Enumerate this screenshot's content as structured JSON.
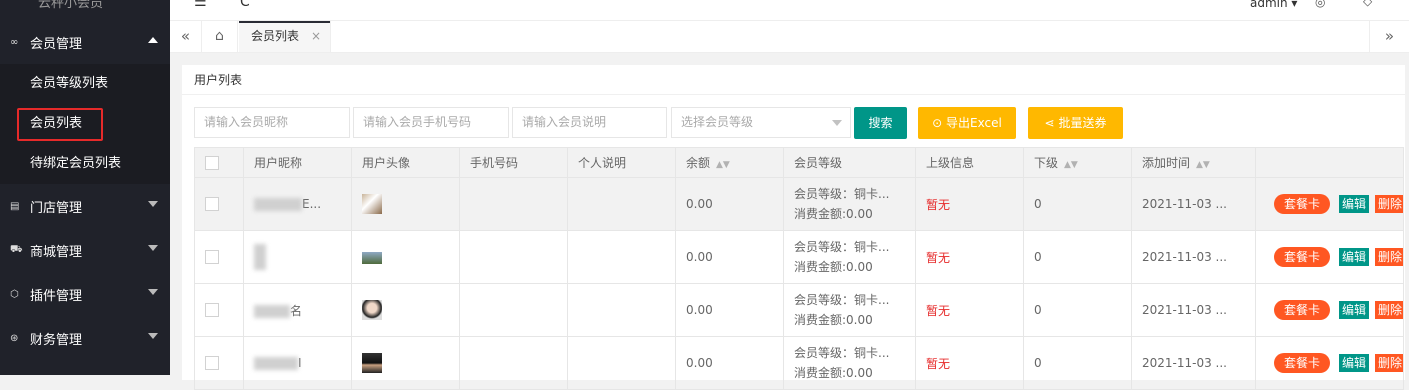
{
  "sidebar": {
    "brand": "云秤小会员",
    "groups": [
      {
        "label": "会员管理",
        "icon": "member-icon",
        "expanded": true
      },
      {
        "label": "门店管理",
        "icon": "store-icon",
        "expanded": false
      },
      {
        "label": "商城管理",
        "icon": "cart-icon",
        "expanded": false
      },
      {
        "label": "插件管理",
        "icon": "plugin-icon",
        "expanded": false
      },
      {
        "label": "财务管理",
        "icon": "finance-icon",
        "expanded": false
      }
    ],
    "subitems": [
      {
        "label": "会员等级列表"
      },
      {
        "label": "会员列表",
        "active": true
      },
      {
        "label": "待绑定会员列表"
      }
    ]
  },
  "topbar": {
    "user": "admin ▾"
  },
  "tabs": {
    "active_label": "会员列表"
  },
  "panel": {
    "title": "用户列表"
  },
  "filters": {
    "nickname_placeholder": "请输入会员昵称",
    "phone_placeholder": "请输入会员手机号码",
    "desc_placeholder": "请输入会员说明",
    "level_placeholder": "选择会员等级",
    "search_label": "搜索",
    "excel_label": "导出Excel",
    "coupon_label": "批量送券"
  },
  "table": {
    "headers": [
      "用户昵称",
      "用户头像",
      "手机号码",
      "个人说明",
      "余额",
      "会员等级",
      "上级信息",
      "下级",
      "添加时间"
    ],
    "rows": [
      {
        "nick_suffix": "E...",
        "balance": "0.00",
        "level": "会员等级：铜卡...",
        "spend": "消费金额:0.00",
        "parent": "暂无",
        "children": "0",
        "time": "2021-11-03 ..."
      },
      {
        "nick_suffix": "",
        "balance": "0.00",
        "level": "会员等级：铜卡...",
        "spend": "消费金额:0.00",
        "parent": "暂无",
        "children": "0",
        "time": "2021-11-03 ..."
      },
      {
        "nick_suffix": "名",
        "balance": "0.00",
        "level": "会员等级：铜卡...",
        "spend": "消费金额:0.00",
        "parent": "暂无",
        "children": "0",
        "time": "2021-11-03 ..."
      },
      {
        "nick_suffix": "I",
        "balance": "0.00",
        "level": "会员等级：铜卡...",
        "spend": "消费金额:0.00",
        "parent": "暂无",
        "children": "0",
        "time": "2021-11-03 ..."
      }
    ],
    "actions": {
      "card": "套餐卡",
      "edit": "编辑",
      "delete": "删除"
    }
  },
  "colors": {
    "sidebar": "#20222a",
    "primary": "#009688",
    "warn": "#ffb800",
    "danger": "#ff5722",
    "highlight": "#e62a2a"
  }
}
